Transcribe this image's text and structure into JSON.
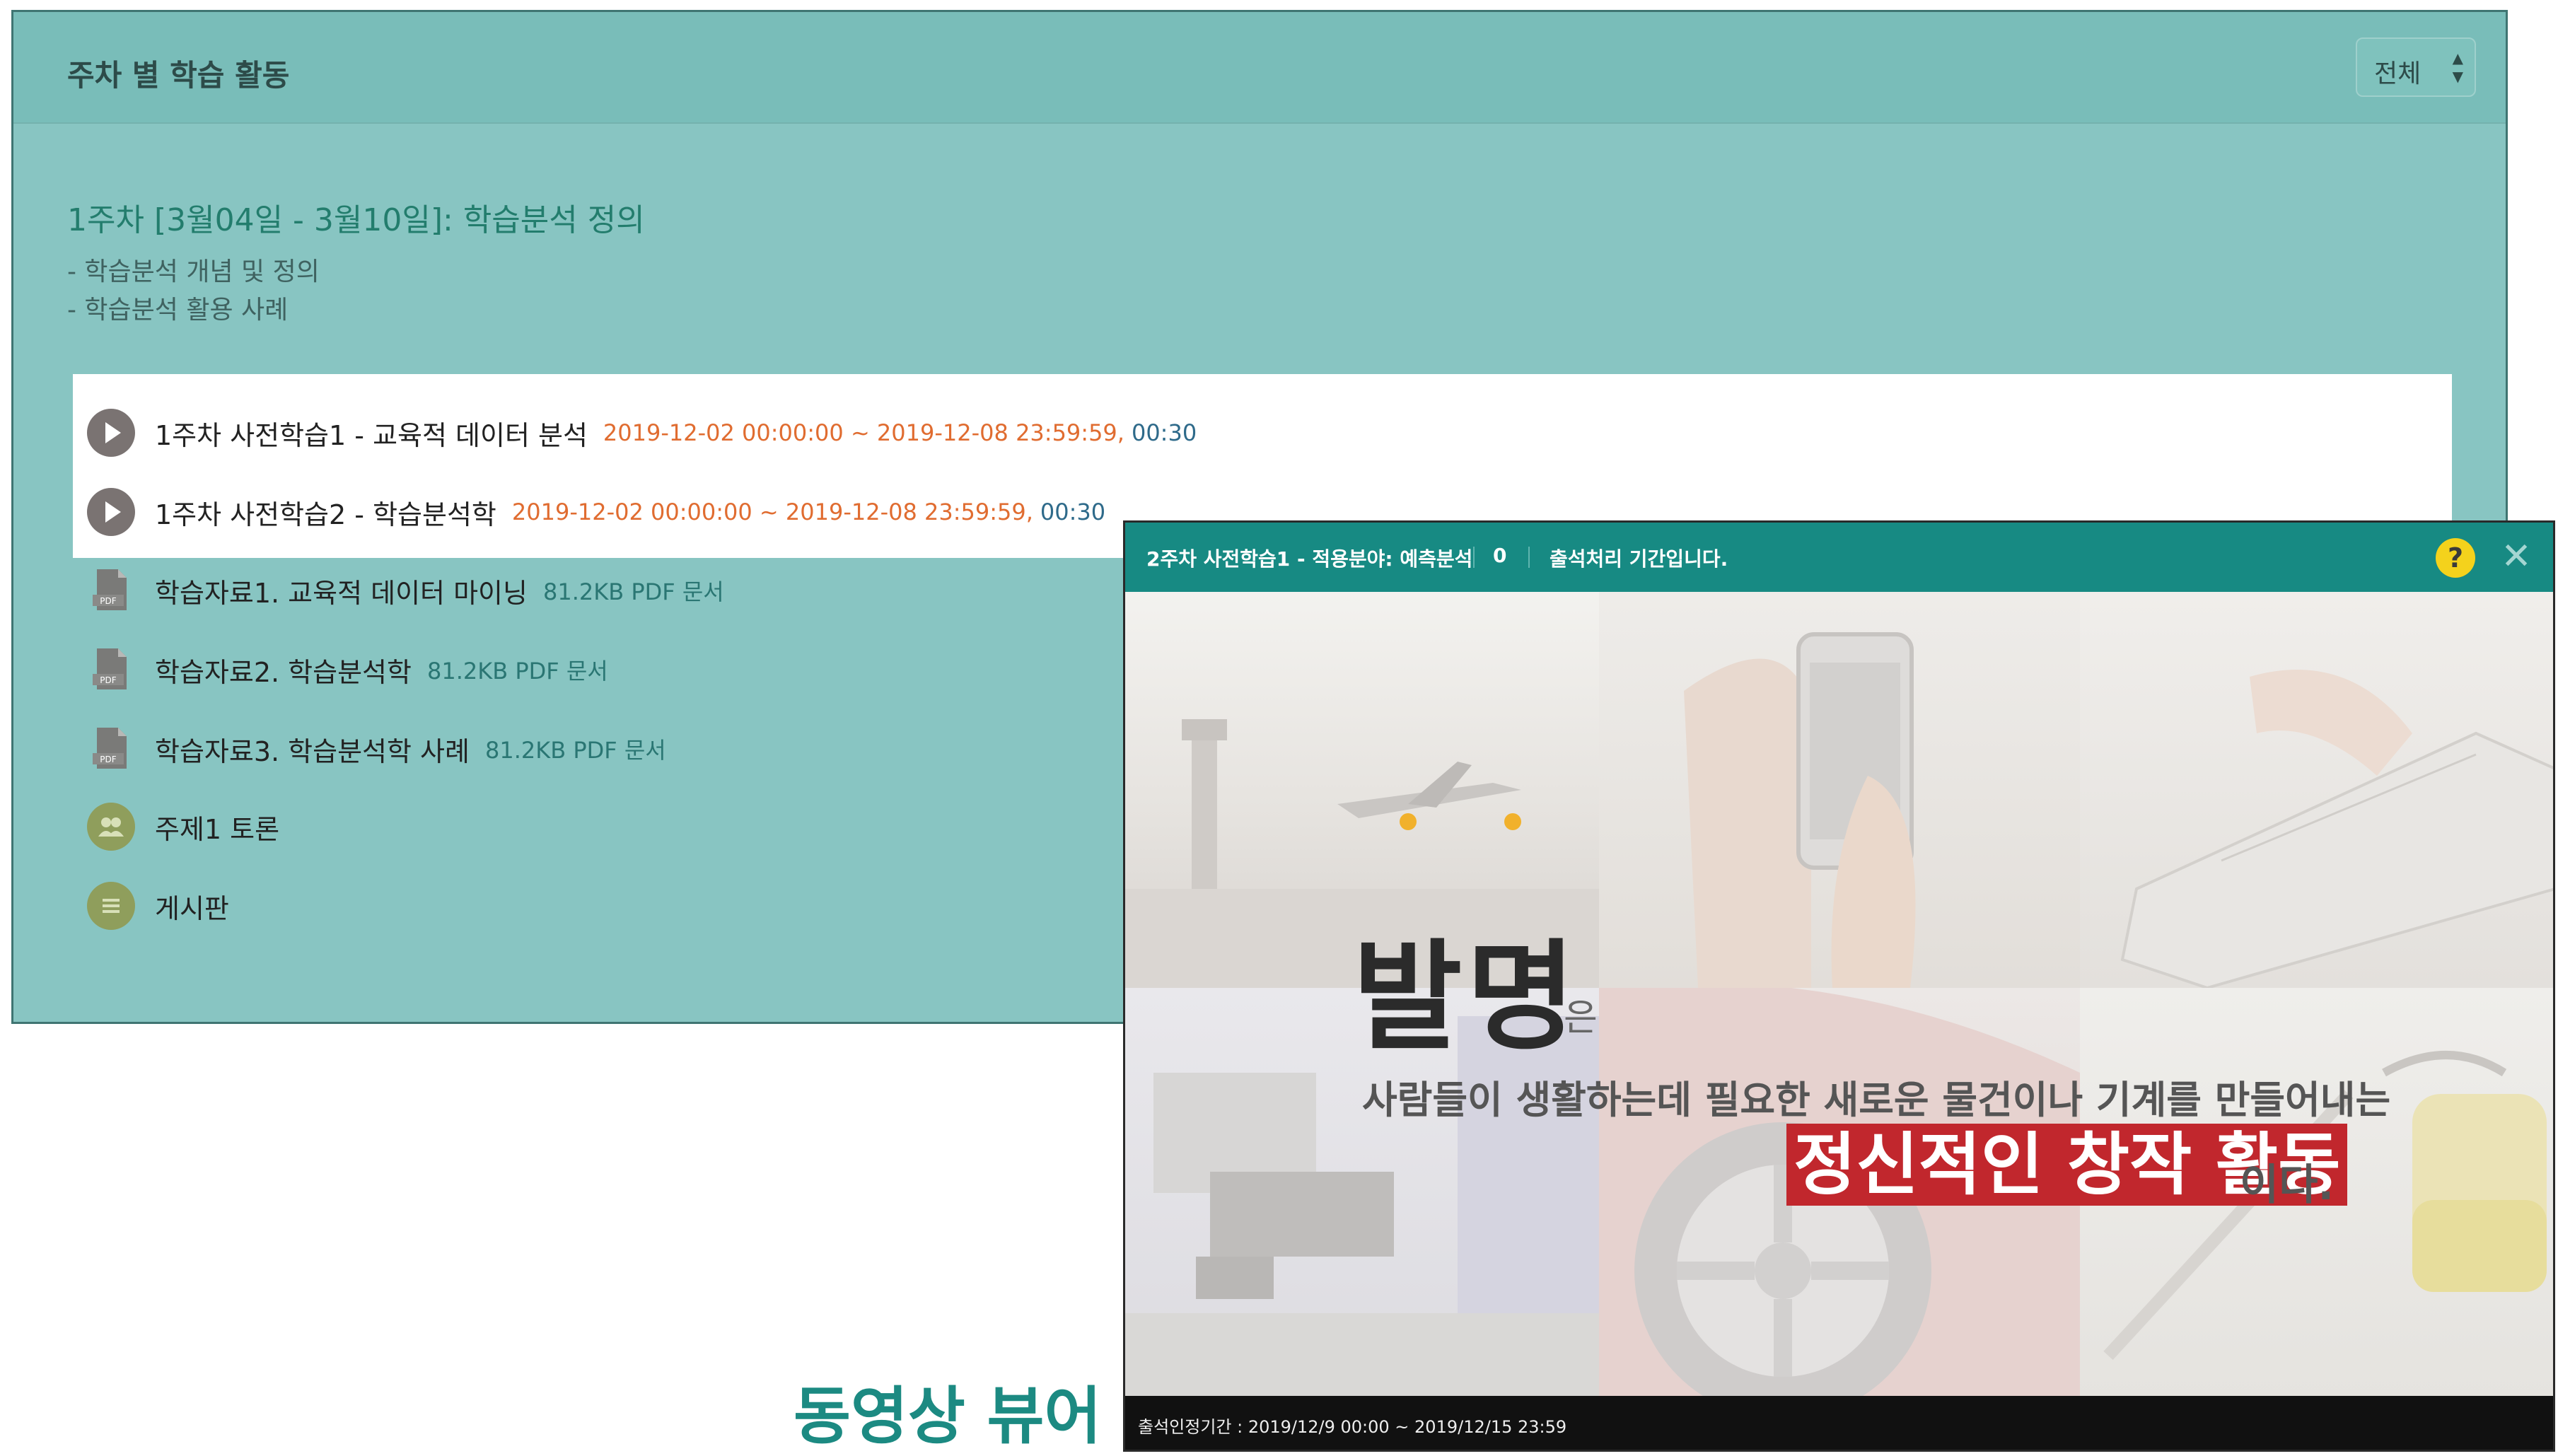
{
  "panel": {
    "title": "주차 별 학습 활동",
    "filter_value": "전체"
  },
  "week": {
    "title": "1주차 [3월04일 - 3월10일]: 학습분석 정의",
    "desc": [
      "- 학습분석 개념 및 정의",
      "- 학습분석 활용 사례"
    ]
  },
  "videos": [
    {
      "name": "1주차 사전학습1 - 교육적 데이터 분석",
      "date": "2019-12-02 00:00:00 ~ 2019-12-08 23:59:59",
      "sep": ",",
      "duration": "00:30",
      "icon": "play-icon"
    },
    {
      "name": "1주차 사전학습2 - 학습분석학",
      "date": "2019-12-02 00:00:00 ~ 2019-12-08 23:59:59",
      "sep": ",",
      "duration": "00:30",
      "icon": "play-icon"
    }
  ],
  "files": [
    {
      "name": "학습자료1. 교육적 데이터 마이닝",
      "meta": "81.2KB PDF 문서",
      "icon": "pdf-icon",
      "icon_text": "PDF"
    },
    {
      "name": "학습자료2. 학습분석학",
      "meta": "81.2KB PDF 문서",
      "icon": "pdf-icon",
      "icon_text": "PDF"
    },
    {
      "name": "학습자료3. 학습분석학 사례",
      "meta": "81.2KB PDF 문서",
      "icon": "pdf-icon",
      "icon_text": "PDF"
    }
  ],
  "others": [
    {
      "name": "주제1 토론",
      "icon": "discussion-icon"
    },
    {
      "name": "게시판",
      "icon": "board-icon"
    }
  ],
  "viewer": {
    "title": "2주차 사전학습1 - 적용분야: 예측분석",
    "count": "0",
    "status": "출석처리 기간입니다.",
    "help_label": "?",
    "close_label": "✕",
    "hero_big": "발명",
    "hero_particle": "은",
    "hero_line": "사람들이 생활하는데 필요한 새로운 물건이나 기계를 만들어내는",
    "hero_highlight": "정신적인 창작 활동",
    "hero_tail": "이다.",
    "footer": "출석인정기간 : 2019/12/9 00:00 ~ 2019/12/15 23:59"
  },
  "caption": "동영상 뷰어",
  "colors": {
    "panel_bg": "#88c5c2",
    "header_bg": "#79bdb9",
    "viewer_bar": "#178a83",
    "date_orange": "#e06c30",
    "highlight_red": "#c1272d",
    "caption_teal": "#1c8a82"
  }
}
